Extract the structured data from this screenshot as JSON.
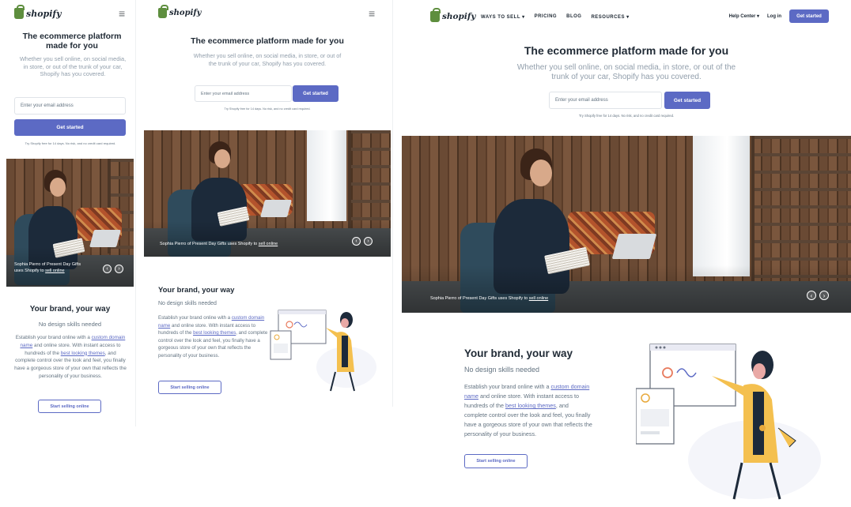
{
  "brand": {
    "logo_text": "shopify",
    "colors": {
      "accent": "#5c6ac4",
      "logo_green": "#5e8e3e",
      "text": "#212b36",
      "muted": "#637381"
    }
  },
  "nav": {
    "ways_to_sell": "WAYS TO SELL",
    "pricing": "PRICING",
    "blog": "BLOG",
    "resources": "RESOURCES",
    "help_center": "Help Center",
    "log_in": "Log in",
    "get_started": "Get started",
    "menu_icon": "hamburger-icon"
  },
  "hero": {
    "title": "The ecommerce platform made for you",
    "subtitle": "Whether you sell online, on social media, in store, or out of the trunk of your car, Shopify has you covered.",
    "email_placeholder": "Enter your email address",
    "cta": "Get started",
    "fine_print": "Try Shopify free for 14 days. No risk, and no credit card required."
  },
  "photo": {
    "caption_name": "Sophia Pierro of Present Day Gifts",
    "caption_mid": "uses Shopify to",
    "caption_link": "sell online",
    "prev_icon": "chevron-left-icon",
    "next_icon": "chevron-right-icon"
  },
  "feature": {
    "title": "Your brand, your way",
    "subtitle": "No design skills needed",
    "body_1": "Establish your brand online with a",
    "link_1": "custom domain name",
    "body_2": "and online store. With instant access to hundreds of the",
    "link_2": "best looking themes",
    "body_3": ", and complete control over the look and feel, you finally have a gorgeous store of your own that reflects the personality of your business.",
    "cta": "Start selling online"
  }
}
